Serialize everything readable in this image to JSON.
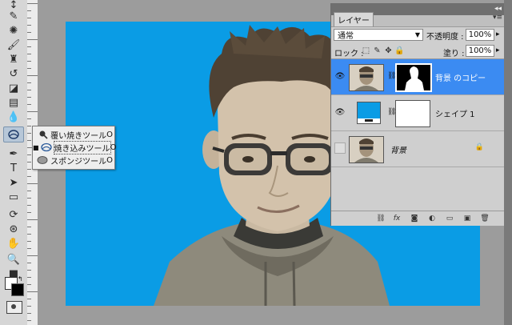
{
  "flyout": {
    "items": [
      {
        "label": "覆い焼きツール",
        "key": "O",
        "selected": false
      },
      {
        "label": "焼き込みツール",
        "key": "O",
        "selected": true
      },
      {
        "label": "スポンジツール",
        "key": "O",
        "selected": false
      }
    ]
  },
  "layers_panel": {
    "tab_label": "レイヤー",
    "blend_mode": "通常",
    "opacity_label": "不透明度 :",
    "opacity_value": "100%",
    "lock_label": "ロック :",
    "fill_label": "塗り :",
    "fill_value": "100%",
    "layers": [
      {
        "name": "背景 のコピー",
        "selected": true,
        "visible": true
      },
      {
        "name": "シェイプ 1",
        "selected": false,
        "visible": true
      },
      {
        "name": "背景",
        "selected": false,
        "visible": false,
        "locked": true
      }
    ]
  },
  "colors": {
    "canvas_background": "#0a9ce5",
    "selected_layer": "#3b8bf2",
    "foreground_swatch": "#ffffff",
    "background_swatch": "#000000"
  }
}
